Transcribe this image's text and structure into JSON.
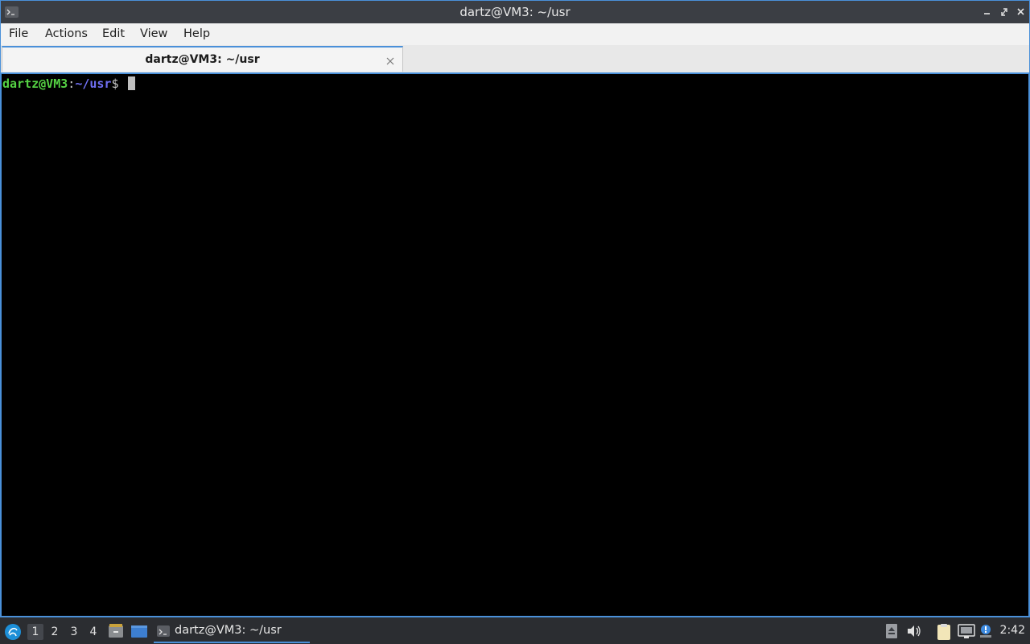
{
  "window": {
    "title": "dartz@VM3: ~/usr"
  },
  "menubar": {
    "items": [
      "File",
      "Actions",
      "Edit",
      "View",
      "Help"
    ]
  },
  "tabs": [
    {
      "label": "dartz@VM3: ~/usr",
      "active": true
    }
  ],
  "terminal": {
    "prompt_user": "dartz@VM3",
    "prompt_sep": ":",
    "prompt_path": "~/usr",
    "prompt_symbol": "$"
  },
  "taskbar": {
    "workspaces": [
      "1",
      "2",
      "3",
      "4"
    ],
    "active_workspace": "1",
    "task_label": "dartz@VM3: ~/usr",
    "clock": "2:42"
  },
  "colors": {
    "accent": "#4a90d9",
    "prompt_user": "#55d244",
    "prompt_path": "#6f6ff2",
    "titlebar_bg": "#3b3e44",
    "taskbar_bg": "#2b2d31"
  }
}
